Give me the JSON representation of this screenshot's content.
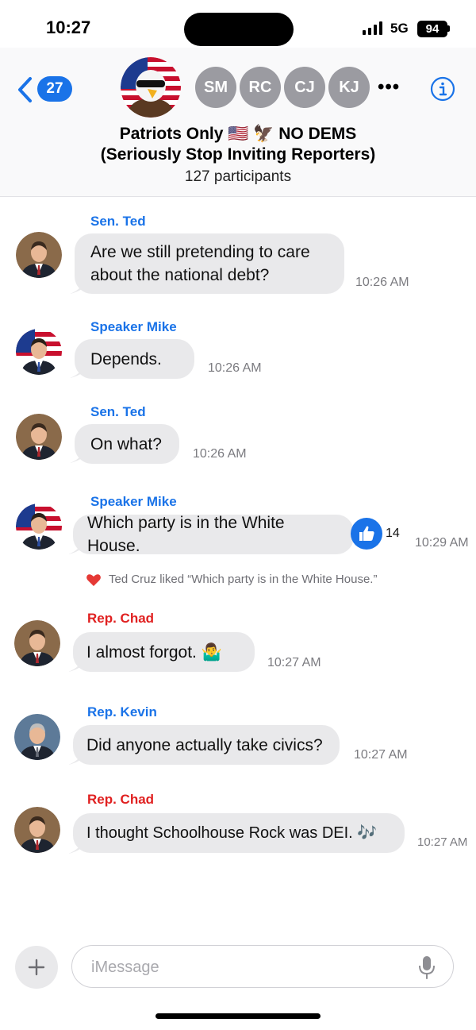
{
  "status_bar": {
    "time": "10:27",
    "network": "5G",
    "battery": "94"
  },
  "header": {
    "back_count": "27",
    "members": [
      "SM",
      "RC",
      "CJ",
      "KJ"
    ],
    "more": "•••",
    "title_line1": "Patriots Only 🇺🇸 🦅 NO DEMS",
    "title_line2": "(Seriously Stop Inviting Reporters)",
    "participants": "127 participants"
  },
  "messages": [
    {
      "sender": "Sen. Ted",
      "text": "Are we still pretending to care about the national debt?",
      "time": "10:26 AM",
      "sender_color": "#1a73e8"
    },
    {
      "sender": "Speaker Mike",
      "text": "Depends.",
      "time": "10:26 AM",
      "sender_color": "#1a73e8"
    },
    {
      "sender": "Sen. Ted",
      "text": "On what?",
      "time": "10:26 AM",
      "sender_color": "#1a73e8"
    },
    {
      "sender": "Speaker Mike",
      "text": "Which party is in the White House.",
      "time": "10:29 AM",
      "sender_color": "#1a73e8",
      "like_count": "14"
    },
    {
      "sender": "Rep. Chad",
      "text": "I almost forgot. 🤷‍♂️",
      "time": "10:27 AM",
      "sender_color": "#e02020"
    },
    {
      "sender": "Rep. Kevin",
      "text": "Did anyone actually take civics?",
      "time": "10:27 AM",
      "sender_color": "#1a73e8"
    },
    {
      "sender": "Rep. Chad",
      "text": "I thought Schoolhouse Rock was DEI. 🎶",
      "time": "10:27 AM",
      "sender_color": "#e02020"
    }
  ],
  "reaction": {
    "text": "Ted Cruz liked “Which party is in the White House.”"
  },
  "composer": {
    "placeholder": "iMessage"
  },
  "colors": {
    "accent": "#1a73e8",
    "bubble": "#e9e9eb",
    "red_sender": "#e02020",
    "heart": "#e53935"
  },
  "icons": {
    "back": "chevron-left-icon",
    "info": "info-circle-icon",
    "plus": "plus-icon",
    "mic": "microphone-icon",
    "like": "thumbs-up-icon",
    "heart": "heart-icon"
  }
}
